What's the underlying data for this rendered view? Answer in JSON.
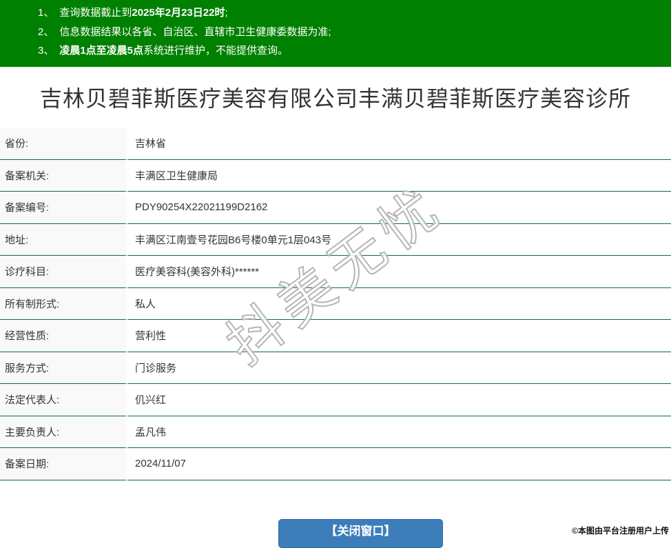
{
  "notice": {
    "items": [
      {
        "num": "1、",
        "pre": "查询数据截止到",
        "bold": "2025年2月23日22时",
        "post": ";"
      },
      {
        "num": "2、",
        "pre": "信息数据结果以各省、自治区、直辖市卫生健康委数据为准;",
        "bold": "",
        "post": ""
      },
      {
        "num": "3、",
        "pre": "",
        "bold": "凌晨1点至凌晨5点",
        "post": "系统进行维护，不能提供查询。"
      }
    ]
  },
  "title": "吉林贝碧菲斯医疗美容有限公司丰满贝碧菲斯医疗美容诊所",
  "table": {
    "rows": [
      {
        "label": "省份:",
        "value": "吉林省"
      },
      {
        "label": "备案机关:",
        "value": "丰满区卫生健康局"
      },
      {
        "label": "备案编号:",
        "value": "PDY90254X22021199D2162"
      },
      {
        "label": "地址:",
        "value": "丰满区江南壹号花园B6号楼0单元1层043号"
      },
      {
        "label": "诊疗科目:",
        "value": "医疗美容科(美容外科)******"
      },
      {
        "label": "所有制形式:",
        "value": "私人"
      },
      {
        "label": "经营性质:",
        "value": "营利性"
      },
      {
        "label": "服务方式:",
        "value": "门诊服务"
      },
      {
        "label": "法定代表人:",
        "value": "仉兴红"
      },
      {
        "label": "主要负责人:",
        "value": "孟凡伟"
      },
      {
        "label": "备案日期:",
        "value": "2024/11/07"
      }
    ]
  },
  "watermark": "抖美无忧",
  "close_button_label": "【关闭窗口】",
  "footer_credit": "©本图由平台注册用户上传",
  "colors": {
    "header_bg": "#008000",
    "row_border": "#0e6b3d",
    "label_bg": "#f9f9f9",
    "button_bg": "#3d7dba",
    "text": "#333333",
    "watermark_stroke": "#b5b5b5"
  }
}
